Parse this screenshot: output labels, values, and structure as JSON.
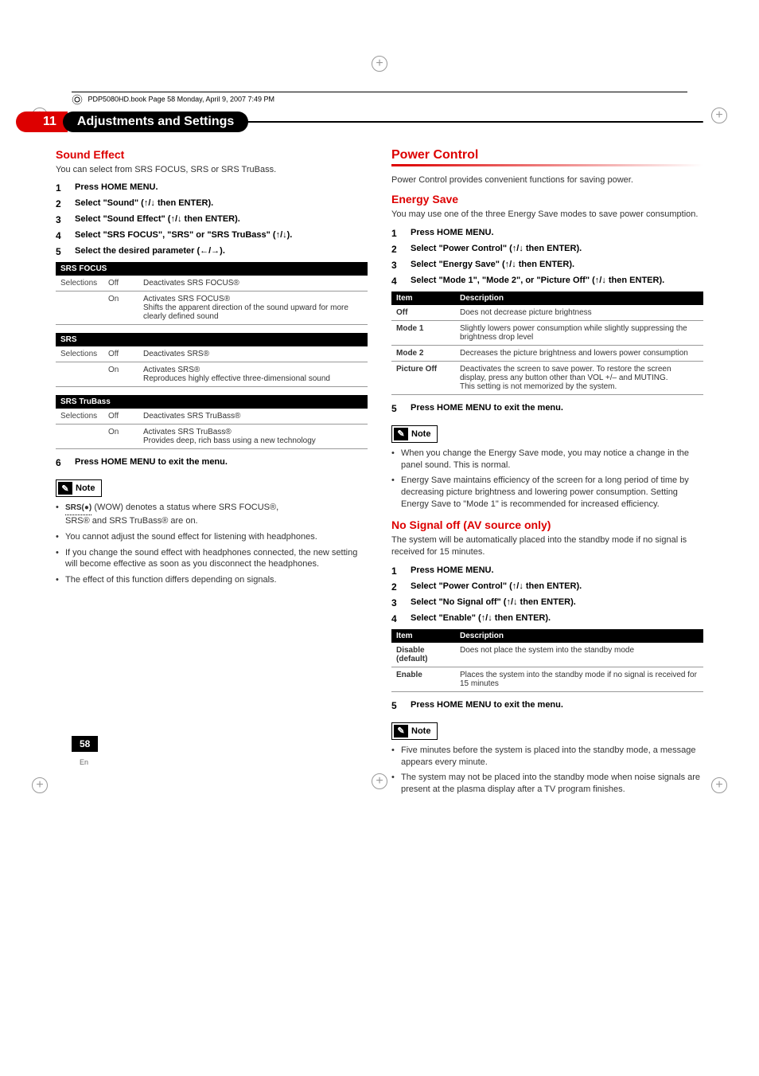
{
  "header": {
    "book_info": "PDP5080HD.book  Page 58  Monday, April 9, 2007  7:49 PM"
  },
  "chapter": {
    "number": "11",
    "title": "Adjustments and Settings"
  },
  "left": {
    "section1_title": "Sound Effect",
    "section1_intro": "You can select from SRS FOCUS, SRS or SRS TruBass.",
    "steps": [
      "Press HOME MENU.",
      "Select \"Sound\" (↑/↓ then ENTER).",
      "Select \"Sound Effect\" (↑/↓ then ENTER).",
      "Select \"SRS FOCUS\", \"SRS\" or \"SRS TruBass\" (↑/↓).",
      "Select the desired parameter (←/→)."
    ],
    "table1_header": "SRS FOCUS",
    "table1": [
      [
        "Selections",
        "Off",
        "Deactivates SRS FOCUS®"
      ],
      [
        "",
        "On",
        "Activates SRS FOCUS®\nShifts the apparent direction of the sound upward for more clearly defined sound"
      ]
    ],
    "table2_header": "SRS",
    "table2": [
      [
        "Selections",
        "Off",
        "Deactivates SRS®"
      ],
      [
        "",
        "On",
        "Activates SRS®\nReproduces highly effective three-dimensional sound"
      ]
    ],
    "table3_header": "SRS TruBass",
    "table3": [
      [
        "Selections",
        "Off",
        "Deactivates SRS TruBass®"
      ],
      [
        "",
        "On",
        "Activates SRS TruBass®\nProvides deep, rich bass using a new technology"
      ]
    ],
    "step6": "Press HOME MENU to exit the menu.",
    "note_title": "Note",
    "note_prefix": "SRS(●)",
    "note_line1": " (WOW) denotes a status where SRS FOCUS®,",
    "note_line1b": "SRS® and SRS TruBass® are on.",
    "notes": [
      "You cannot adjust the sound effect for listening with headphones.",
      "If you change the sound effect with headphones connected, the new setting will become effective as soon as you disconnect the headphones.",
      "The effect of this function differs depending on signals."
    ]
  },
  "right": {
    "major_title": "Power Control",
    "major_intro": "Power Control provides convenient functions for saving power.",
    "section1_title": "Energy Save",
    "section1_intro": "You may use one of the three Energy Save modes to save power consumption.",
    "steps1": [
      "Press HOME MENU.",
      "Select \"Power Control\" (↑/↓ then ENTER).",
      "Select \"Energy Save\" (↑/↓ then ENTER).",
      "Select \"Mode 1\", \"Mode 2\", or \"Picture Off\" (↑/↓ then ENTER)."
    ],
    "itable1_headers": [
      "Item",
      "Description"
    ],
    "itable1": [
      [
        "Off",
        "Does not decrease picture brightness"
      ],
      [
        "Mode 1",
        "Slightly lowers power consumption while slightly suppressing the brightness drop level"
      ],
      [
        "Mode 2",
        "Decreases the picture brightness and lowers power consumption"
      ],
      [
        "Picture Off",
        "Deactivates the screen to save power. To restore the screen display, press any button other than VOL +/– and MUTING.\nThis setting is not memorized by the system."
      ]
    ],
    "step5a": "Press HOME MENU to exit the menu.",
    "note1_title": "Note",
    "notes1": [
      "When you change the Energy Save mode, you may notice a change in the panel sound. This is normal.",
      "Energy Save maintains efficiency of the screen for a long period of time by decreasing picture brightness and lowering power consumption. Setting Energy Save to \"Mode 1\" is recommended for increased efficiency."
    ],
    "section2_title": "No Signal off (AV source only)",
    "section2_intro": "The system will be automatically placed into the standby mode if no signal is received for 15 minutes.",
    "steps2": [
      "Press HOME MENU.",
      "Select \"Power Control\" (↑/↓ then ENTER).",
      "Select \"No Signal off\" (↑/↓ then ENTER).",
      "Select \"Enable\" (↑/↓ then ENTER)."
    ],
    "itable2_headers": [
      "Item",
      "Description"
    ],
    "itable2": [
      [
        "Disable (default)",
        "Does not place the system into the standby mode"
      ],
      [
        "Enable",
        "Places the system into the standby mode if no signal is received for 15 minutes"
      ]
    ],
    "step5b": "Press HOME MENU to exit the menu.",
    "note2_title": "Note",
    "notes2": [
      "Five minutes before the system is placed into the standby mode, a message appears every minute.",
      "The system may not be placed into the standby mode when noise signals are present at the plasma display after a TV program finishes."
    ]
  },
  "page": {
    "number": "58",
    "lang": "En"
  }
}
